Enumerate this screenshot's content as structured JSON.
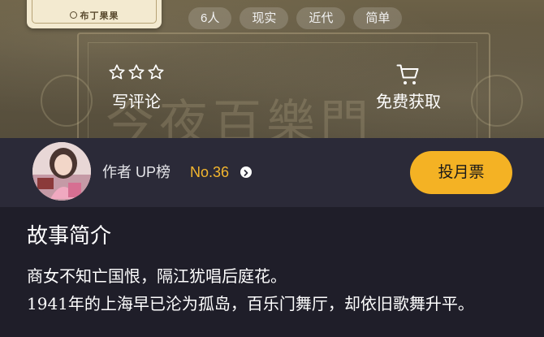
{
  "hero": {
    "cover_author": "布丁果果",
    "watermark": "今夜百樂門",
    "tags": [
      "6人",
      "现实",
      "近代",
      "简单"
    ],
    "review": {
      "label": "写评论",
      "icon": "star-outline-icon",
      "star_count": 3
    },
    "free": {
      "label": "免费获取",
      "icon": "cart-icon"
    }
  },
  "author_bar": {
    "rank_label": "作者 UP榜",
    "rank_value": "No.36",
    "vote_label": "投月票",
    "accent_color": "#f4b224"
  },
  "synopsis": {
    "title": "故事简介",
    "lines": [
      "商女不知亡国恨，隔江犹唱后庭花。",
      "1941年的上海早已沦为孤岛，百乐门舞厅，却依旧歌舞升平。"
    ]
  }
}
